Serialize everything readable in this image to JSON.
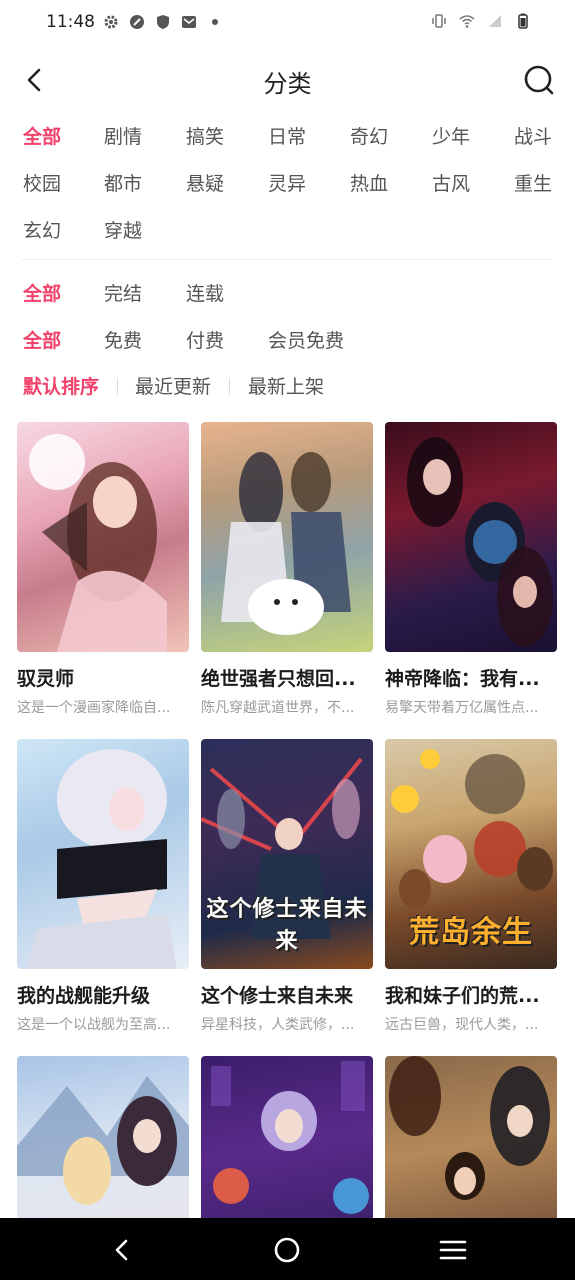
{
  "status": {
    "time": "11:48"
  },
  "header": {
    "title": "分类"
  },
  "filters": {
    "genres": [
      "全部",
      "剧情",
      "搞笑",
      "日常",
      "奇幻",
      "少年",
      "战斗",
      "校园",
      "都市",
      "悬疑",
      "灵异",
      "热血",
      "古风",
      "重生",
      "玄幻",
      "穿越"
    ],
    "status": [
      "全部",
      "完结",
      "连载"
    ],
    "price": [
      "全部",
      "免费",
      "付费",
      "会员免费"
    ],
    "sort": [
      "默认排序",
      "最近更新",
      "最新上架"
    ]
  },
  "comics": [
    {
      "title": "驭灵师",
      "desc": "这是一个漫画家降临自..."
    },
    {
      "title": "绝世强者只想回...",
      "desc": "陈凡穿越武道世界，不..."
    },
    {
      "title": "神帝降临：我有...",
      "desc": "易擎天带着万亿属性点..."
    },
    {
      "title": "我的战舰能升级",
      "desc": "这是一个以战舰为至高..."
    },
    {
      "title": "这个修士来自未来",
      "desc": "异星科技，人类武修，...",
      "cover_text": "这个修士来自未来"
    },
    {
      "title": "我和妹子们的荒...",
      "desc": "远古巨兽，现代人类，...",
      "cover_text": "荒岛余生"
    },
    {
      "title": "",
      "desc": ""
    },
    {
      "title": "",
      "desc": ""
    },
    {
      "title": "",
      "desc": ""
    }
  ],
  "colors": {
    "accent": "#f0426b",
    "text": "#222222",
    "muted": "#9a9a9a",
    "navbar": "#000000"
  }
}
